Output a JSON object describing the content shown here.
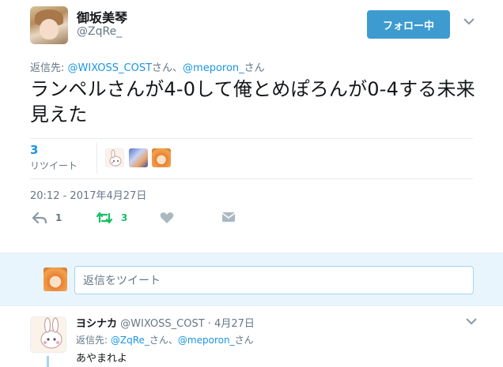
{
  "tweet": {
    "display_name": "御坂美琴",
    "username": "@ZqRe_",
    "follow_button": "フォロー中",
    "reply_prefix": "返信先: ",
    "reply_mention1": "@WIXOSS_COST",
    "reply_san1": "さん、",
    "reply_mention2": "@meporon_",
    "reply_san2": "さん",
    "text": "ランペルさんが4-0して俺とめぽろんが0-4する未来見えた",
    "retweet_count": "3",
    "retweet_label": "リツイート",
    "timestamp": "20:12 - 2017年4月27日",
    "actions": {
      "reply_count": "1",
      "retweet_count": "3"
    }
  },
  "reply_box": {
    "placeholder": "返信をツイート"
  },
  "reply": {
    "display_name": "ヨシナカ",
    "meta": " @WIXOSS_COST · 4月27日",
    "reply_prefix": "返信先: ",
    "reply_mention1": "@ZqRe_",
    "reply_san1": "さん、",
    "reply_mention2": "@meporon_",
    "reply_san2": "さん",
    "text": "あやまれよ"
  },
  "colors": {
    "accent": "#1b95e0",
    "follow_button": "#3d9bd0",
    "retweet_green": "#17bf63",
    "muted": "#657786",
    "reply_area_bg": "#e8f5fd"
  }
}
